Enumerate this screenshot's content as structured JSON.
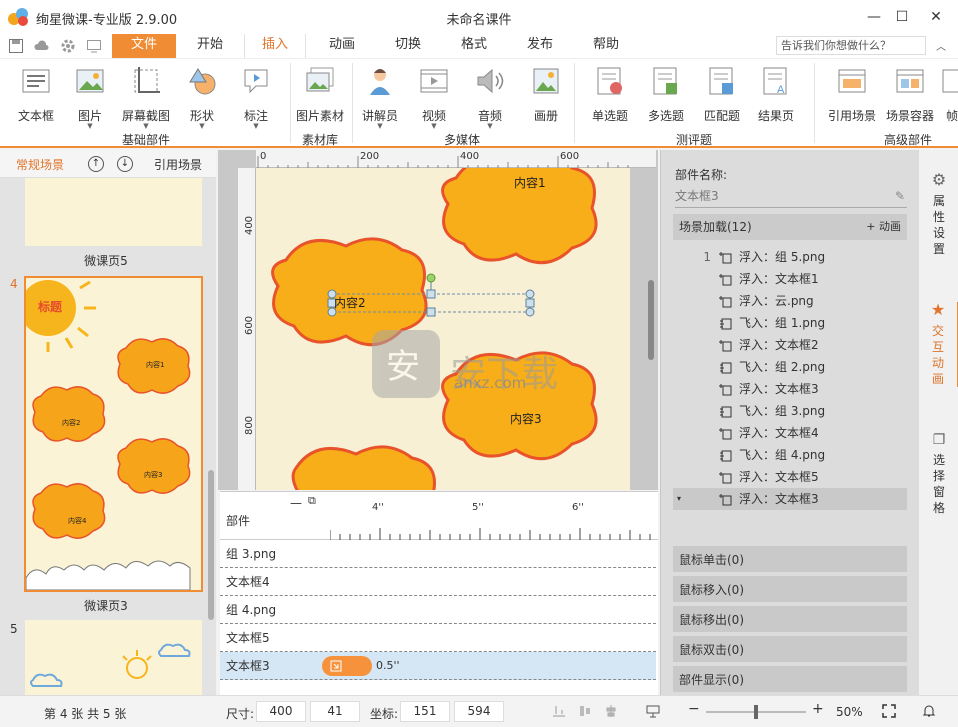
{
  "app": {
    "title": "绚星微课-专业版 2.9.00",
    "document_title": "未命名课件"
  },
  "menu": {
    "tabs": [
      "文件",
      "开始",
      "插入",
      "动画",
      "切换",
      "格式",
      "发布",
      "帮助"
    ],
    "active_tab": "插入",
    "help_placeholder": "告诉我们你想做什么？"
  },
  "ribbon": {
    "groups": [
      {
        "label": "基础部件",
        "buttons": [
          "文本框",
          "图片",
          "屏幕截图",
          "形状",
          "标注"
        ]
      },
      {
        "label": "素材库",
        "buttons": [
          "图片素材"
        ]
      },
      {
        "label": "多媒体",
        "buttons": [
          "讲解员",
          "视频",
          "音频",
          "画册"
        ]
      },
      {
        "label": "测评题",
        "buttons": [
          "单选题",
          "多选题",
          "匹配题",
          "结果页"
        ]
      },
      {
        "label": "高级部件",
        "buttons": [
          "引用场景",
          "场景容器",
          "帧"
        ]
      }
    ]
  },
  "left_panel": {
    "tab_label": "常规场景",
    "ref_label": "引用场景",
    "slides": [
      {
        "caption": "微课页5"
      },
      {
        "number": "4",
        "caption": "微课页3",
        "title": "标题",
        "labels": [
          "内容1",
          "内容2",
          "内容3",
          "内容4"
        ]
      },
      {
        "number": "5"
      }
    ]
  },
  "canvas": {
    "ruler_top": [
      "0",
      "200",
      "400",
      "600"
    ],
    "ruler_left": [
      "400",
      "600",
      "800"
    ],
    "content_labels": [
      "内容1",
      "内容2",
      "内容3"
    ],
    "watermark": "anxz.com"
  },
  "timeline": {
    "header": "部件",
    "ruler": [
      "4''",
      "5''",
      "6''"
    ],
    "rows": [
      "组 3.png",
      "文本框4",
      "组 4.png",
      "文本框5",
      "文本框3"
    ],
    "selected_duration": "0.5''"
  },
  "right_panel": {
    "part_name_label": "部件名称:",
    "part_name_value": "文本框3",
    "scene_load_label": "场景加载(12)",
    "add_anim_label": "+ 动画",
    "animations": [
      {
        "num": "1",
        "text": "浮入：组 5.png"
      },
      {
        "num": "",
        "text": "浮入：文本框1"
      },
      {
        "num": "",
        "text": "浮入：云.png"
      },
      {
        "num": "",
        "text": "飞入：组 1.png"
      },
      {
        "num": "",
        "text": "浮入：文本框2"
      },
      {
        "num": "",
        "text": "飞入：组 2.png"
      },
      {
        "num": "",
        "text": "浮入：文本框3"
      },
      {
        "num": "",
        "text": "飞入：组 3.png"
      },
      {
        "num": "",
        "text": "浮入：文本框4"
      },
      {
        "num": "",
        "text": "飞入：组 4.png"
      },
      {
        "num": "",
        "text": "浮入：文本框5"
      },
      {
        "num": "",
        "text": "浮入：文本框3"
      }
    ],
    "events": [
      "鼠标单击(0)",
      "鼠标移入(0)",
      "鼠标移出(0)",
      "鼠标双击(0)",
      "部件显示(0)"
    ]
  },
  "side_tabs": [
    "属性设置",
    "交互动画",
    "选择窗格"
  ],
  "status": {
    "page_info": "第 4 张  共 5 张",
    "size_label": "尺寸:",
    "width": "400",
    "height": "41",
    "coord_label": "坐标:",
    "x": "151",
    "y": "594",
    "zoom": "50%"
  },
  "colors": {
    "accent": "#f08c33",
    "blob": "#f7a81b",
    "blob_edge": "#e8532b"
  }
}
